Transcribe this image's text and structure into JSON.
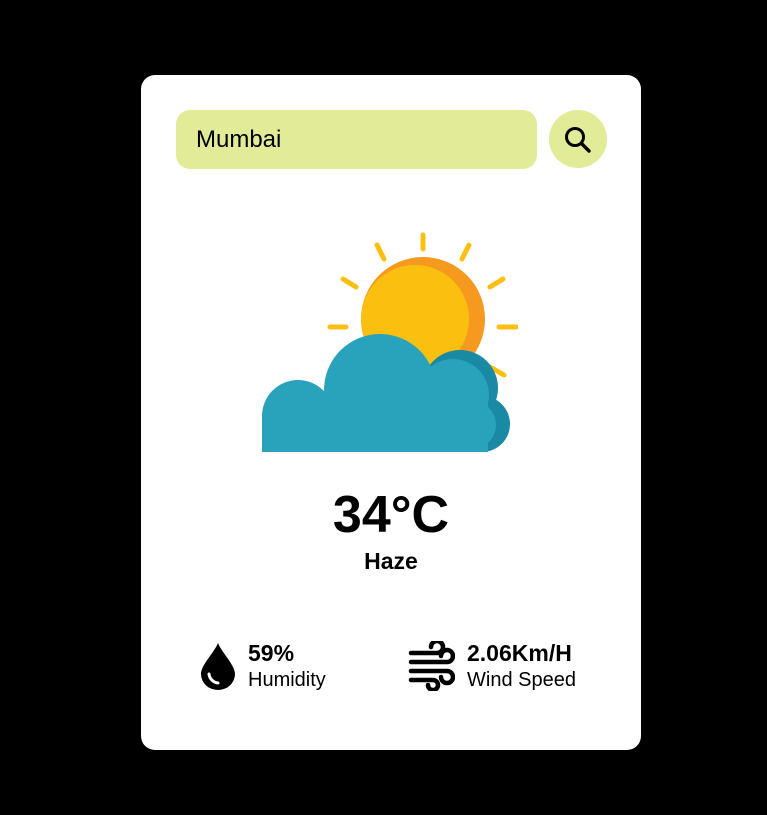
{
  "search": {
    "value": "Mumbai",
    "button_icon": "search-icon"
  },
  "weather": {
    "icon": "partly-cloudy-sun-icon",
    "temperature": "34°C",
    "condition": "Haze"
  },
  "details": {
    "humidity": {
      "icon": "water-drop-icon",
      "value": "59%",
      "label": "Humidity"
    },
    "wind": {
      "icon": "wind-icon",
      "value": "2.06Km/H",
      "label": "Wind Speed"
    }
  },
  "colors": {
    "background": "#000000",
    "card": "#ffffff",
    "accent": "#e2eb98",
    "sun": "#fbbf10",
    "sun_shade": "#f59a1f",
    "cloud": "#29a3bb",
    "cloud_shade": "#1a89a3"
  }
}
